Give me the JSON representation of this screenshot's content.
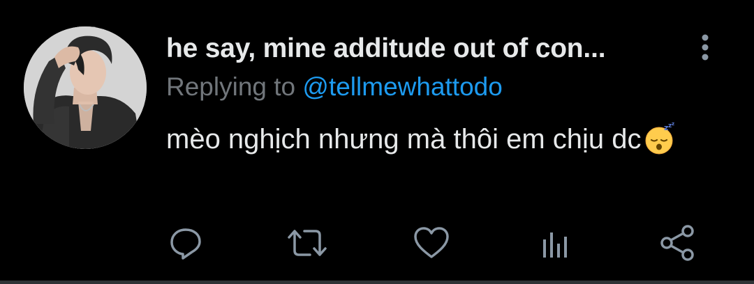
{
  "tweet": {
    "display_name": "he say, mine additude out of con...",
    "reply_prefix": "Replying to ",
    "reply_handle": "@tellmewhattodo",
    "text": "mèo nghịch nhưng mà thôi em chịu dc",
    "emoji": "sleeping-face-emoji"
  },
  "actions": [
    {
      "name": "reply",
      "icon": "reply-icon"
    },
    {
      "name": "retweet",
      "icon": "retweet-icon"
    },
    {
      "name": "like",
      "icon": "heart-icon"
    },
    {
      "name": "analytics",
      "icon": "analytics-icon"
    },
    {
      "name": "share",
      "icon": "share-icon"
    }
  ],
  "colors": {
    "background": "#000000",
    "text_primary": "#e7e9ea",
    "text_secondary": "#71767b",
    "accent": "#1d9bf0",
    "icon": "#8b98a5"
  }
}
